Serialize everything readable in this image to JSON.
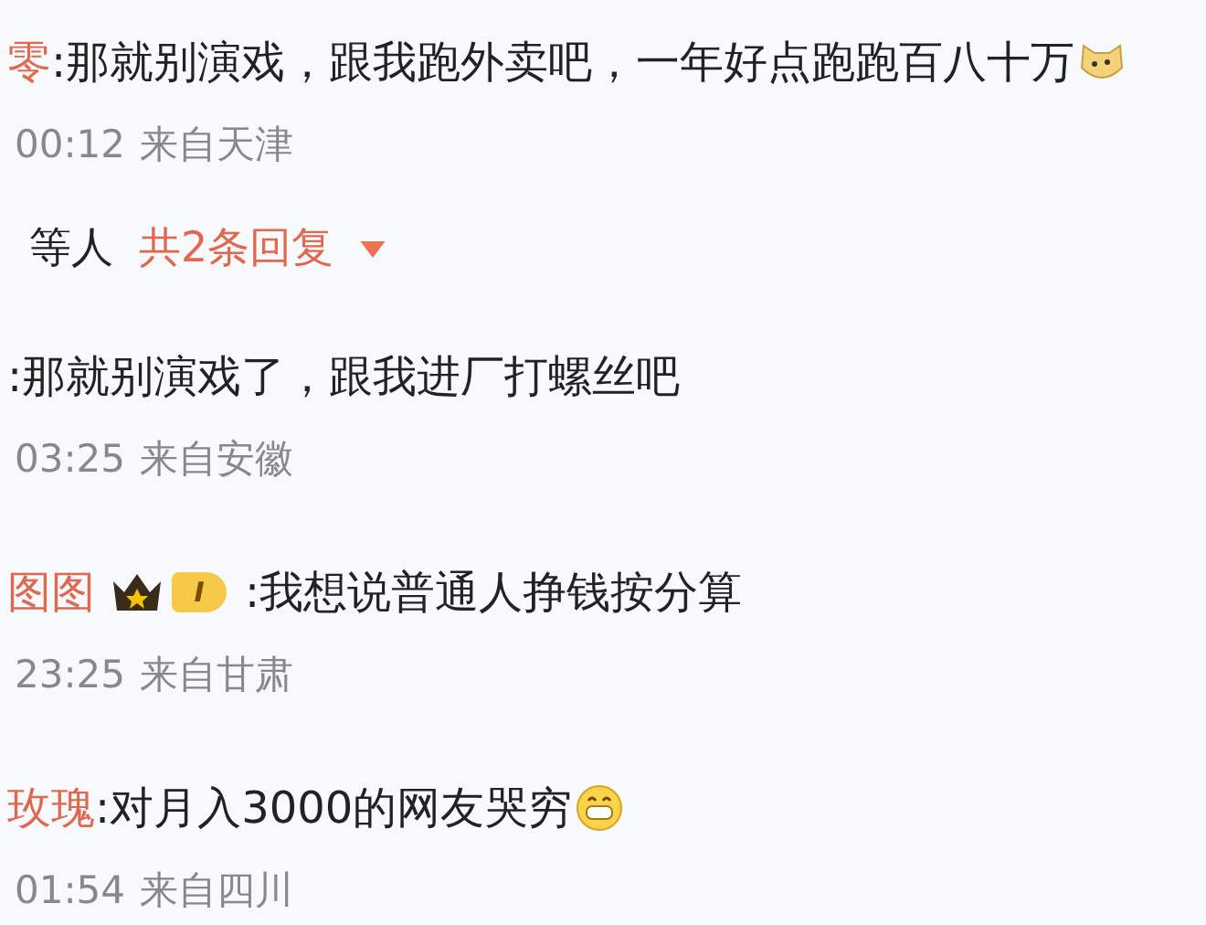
{
  "comments": [
    {
      "kind": "comment",
      "user": "零",
      "text": ":那就别演戏，跟我跑外卖吧，一年好点跑跑百八十万",
      "emoji": {
        "kind": "dog"
      },
      "time": "00:12",
      "location": "来自天津"
    },
    {
      "kind": "replies",
      "users": "等人",
      "count": "共2条回复"
    },
    {
      "kind": "comment",
      "text": ":那就别演戏了，跟我进厂打螺丝吧",
      "time": "03:25",
      "location": "来自安徽"
    },
    {
      "kind": "comment",
      "user": "图图",
      "crown": true,
      "level": "I",
      "text": ":我想说普通人挣钱按分算",
      "time": "23:25",
      "location": "来自甘肃"
    },
    {
      "kind": "comment",
      "user": "玫瑰",
      "text": ":对月入3000的网友哭穷",
      "emoji": {
        "kind": "grin"
      },
      "time": "01:54",
      "location": "来自四川"
    }
  ]
}
